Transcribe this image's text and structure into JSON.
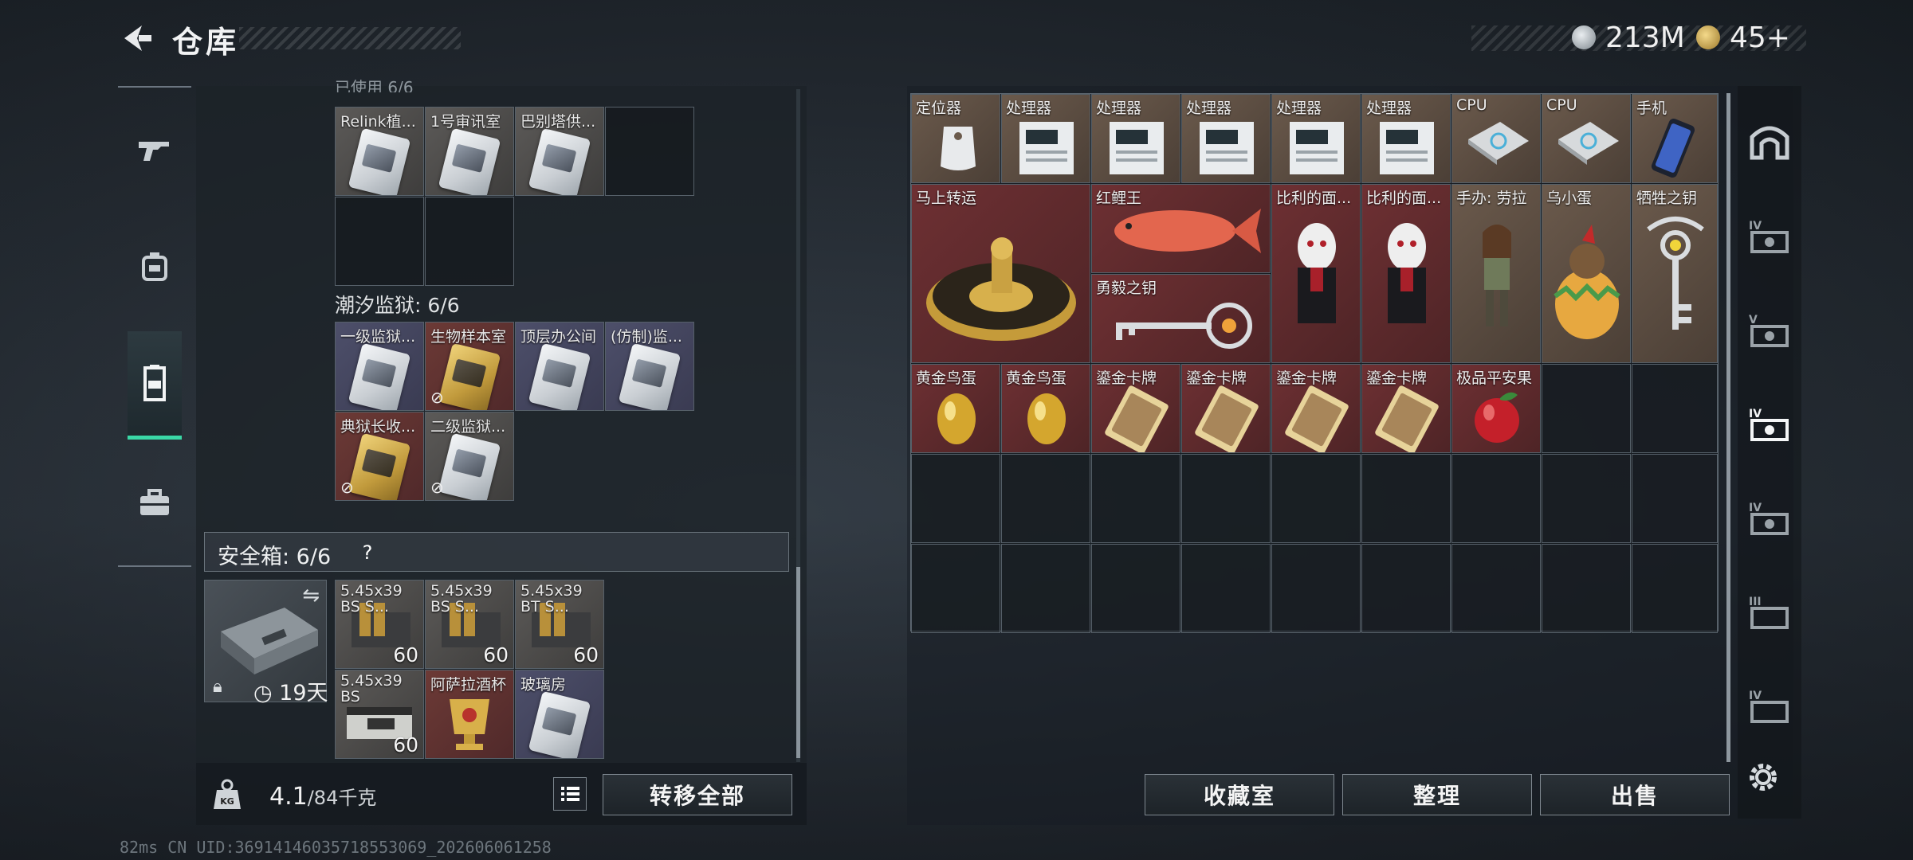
{
  "header": {
    "title": "仓库",
    "currency_silver": "213M",
    "currency_gold": "45+"
  },
  "left_rail": {
    "items": [
      "gun-icon",
      "backpack-icon",
      "vest-icon",
      "toolbox-icon"
    ],
    "active_index": 2
  },
  "key_bag": {
    "section1_label_partial": "已使用 6/6",
    "section1_items": [
      "Relink植...",
      "1号审讯室",
      "巴别塔供..."
    ],
    "section2_label": "潮汐监狱: 6/6",
    "section2_items": [
      "一级监狱...",
      "生物样本室",
      "顶层办公间",
      "(仿制)监...",
      "典狱长收...",
      "二级监狱..."
    ]
  },
  "safe": {
    "title": "安全箱: 6/6",
    "help": "?",
    "timer": "19天",
    "items": [
      {
        "label": "5.45x39 BS S...",
        "qty": "60"
      },
      {
        "label": "5.45x39 BS S...",
        "qty": "60"
      },
      {
        "label": "5.45x39 BT S...",
        "qty": "60"
      },
      {
        "label": "5.45x39 BS",
        "qty": "60"
      },
      {
        "label": "阿萨拉酒杯",
        "qty": ""
      },
      {
        "label": "玻璃房",
        "qty": ""
      }
    ]
  },
  "footer_left": {
    "weight": "4.1",
    "capacity": "/84千克",
    "transfer_all": "转移全部"
  },
  "stash": {
    "row1": [
      "定位器",
      "处理器",
      "处理器",
      "处理器",
      "处理器",
      "处理器",
      "CPU",
      "CPU",
      "手机"
    ],
    "row2_big": [
      "马上转运",
      "红鲤王",
      "勇毅之钥"
    ],
    "row2": [
      "比利的面...",
      "比利的面...",
      "手办: 劳拉",
      "乌小蛋",
      "牺牲之钥"
    ],
    "row3": [
      "黄金鸟蛋",
      "黄金鸟蛋",
      "鎏金卡牌",
      "鎏金卡牌",
      "鎏金卡牌",
      "鎏金卡牌",
      "极品平安果"
    ]
  },
  "buttons": {
    "collection": "收藏室",
    "sort": "整理",
    "sell": "出售"
  },
  "status": {
    "line": "82ms    CN UID:369141460357185530​69_202606061258"
  },
  "colors": {
    "accent_green": "#3ad8a6",
    "slot_red": "#6e3033",
    "slot_brown": "#6b5a4c"
  }
}
